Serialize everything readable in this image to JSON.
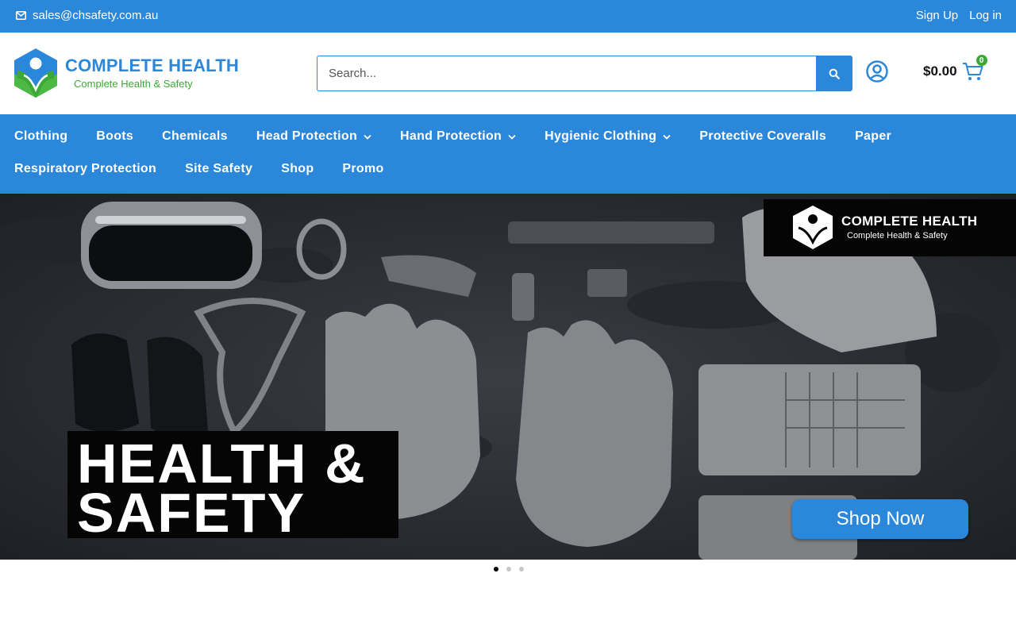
{
  "topbar": {
    "email": "sales@chsafety.com.au",
    "sign_up": "Sign Up",
    "log_in": "Log in"
  },
  "header": {
    "logo_title": "COMPLETE HEALTH",
    "logo_tagline": "Complete Health & Safety",
    "search_placeholder": "Search...",
    "cart_total": "$0.00",
    "cart_count": "0"
  },
  "nav": {
    "row1": [
      {
        "label": "Clothing",
        "dropdown": false
      },
      {
        "label": "Boots",
        "dropdown": false
      },
      {
        "label": "Chemicals",
        "dropdown": false
      },
      {
        "label": "Head Protection",
        "dropdown": true
      },
      {
        "label": "Hand Protection",
        "dropdown": true
      },
      {
        "label": "Hygienic Clothing",
        "dropdown": true
      },
      {
        "label": "Protective Coveralls",
        "dropdown": false
      },
      {
        "label": "Paper",
        "dropdown": false
      }
    ],
    "row2": [
      {
        "label": "Respiratory Protection",
        "dropdown": false
      },
      {
        "label": "Site Safety",
        "dropdown": false
      },
      {
        "label": "Shop",
        "dropdown": false
      },
      {
        "label": "Promo",
        "dropdown": false
      }
    ]
  },
  "hero": {
    "brand_title": "COMPLETE HEALTH",
    "brand_tagline": "Complete Health & Safety",
    "headline_line1": "HEALTH &",
    "headline_line2": "SAFETY",
    "cta": "Shop Now"
  },
  "slider": {
    "slide_count": 3,
    "active_slide": 1
  },
  "colors": {
    "brand_blue": "#2b87da",
    "brand_green": "#3aa935"
  },
  "icons": [
    "envelope-icon",
    "search-icon",
    "user-account-icon",
    "cart-icon",
    "chevron-down-icon"
  ]
}
